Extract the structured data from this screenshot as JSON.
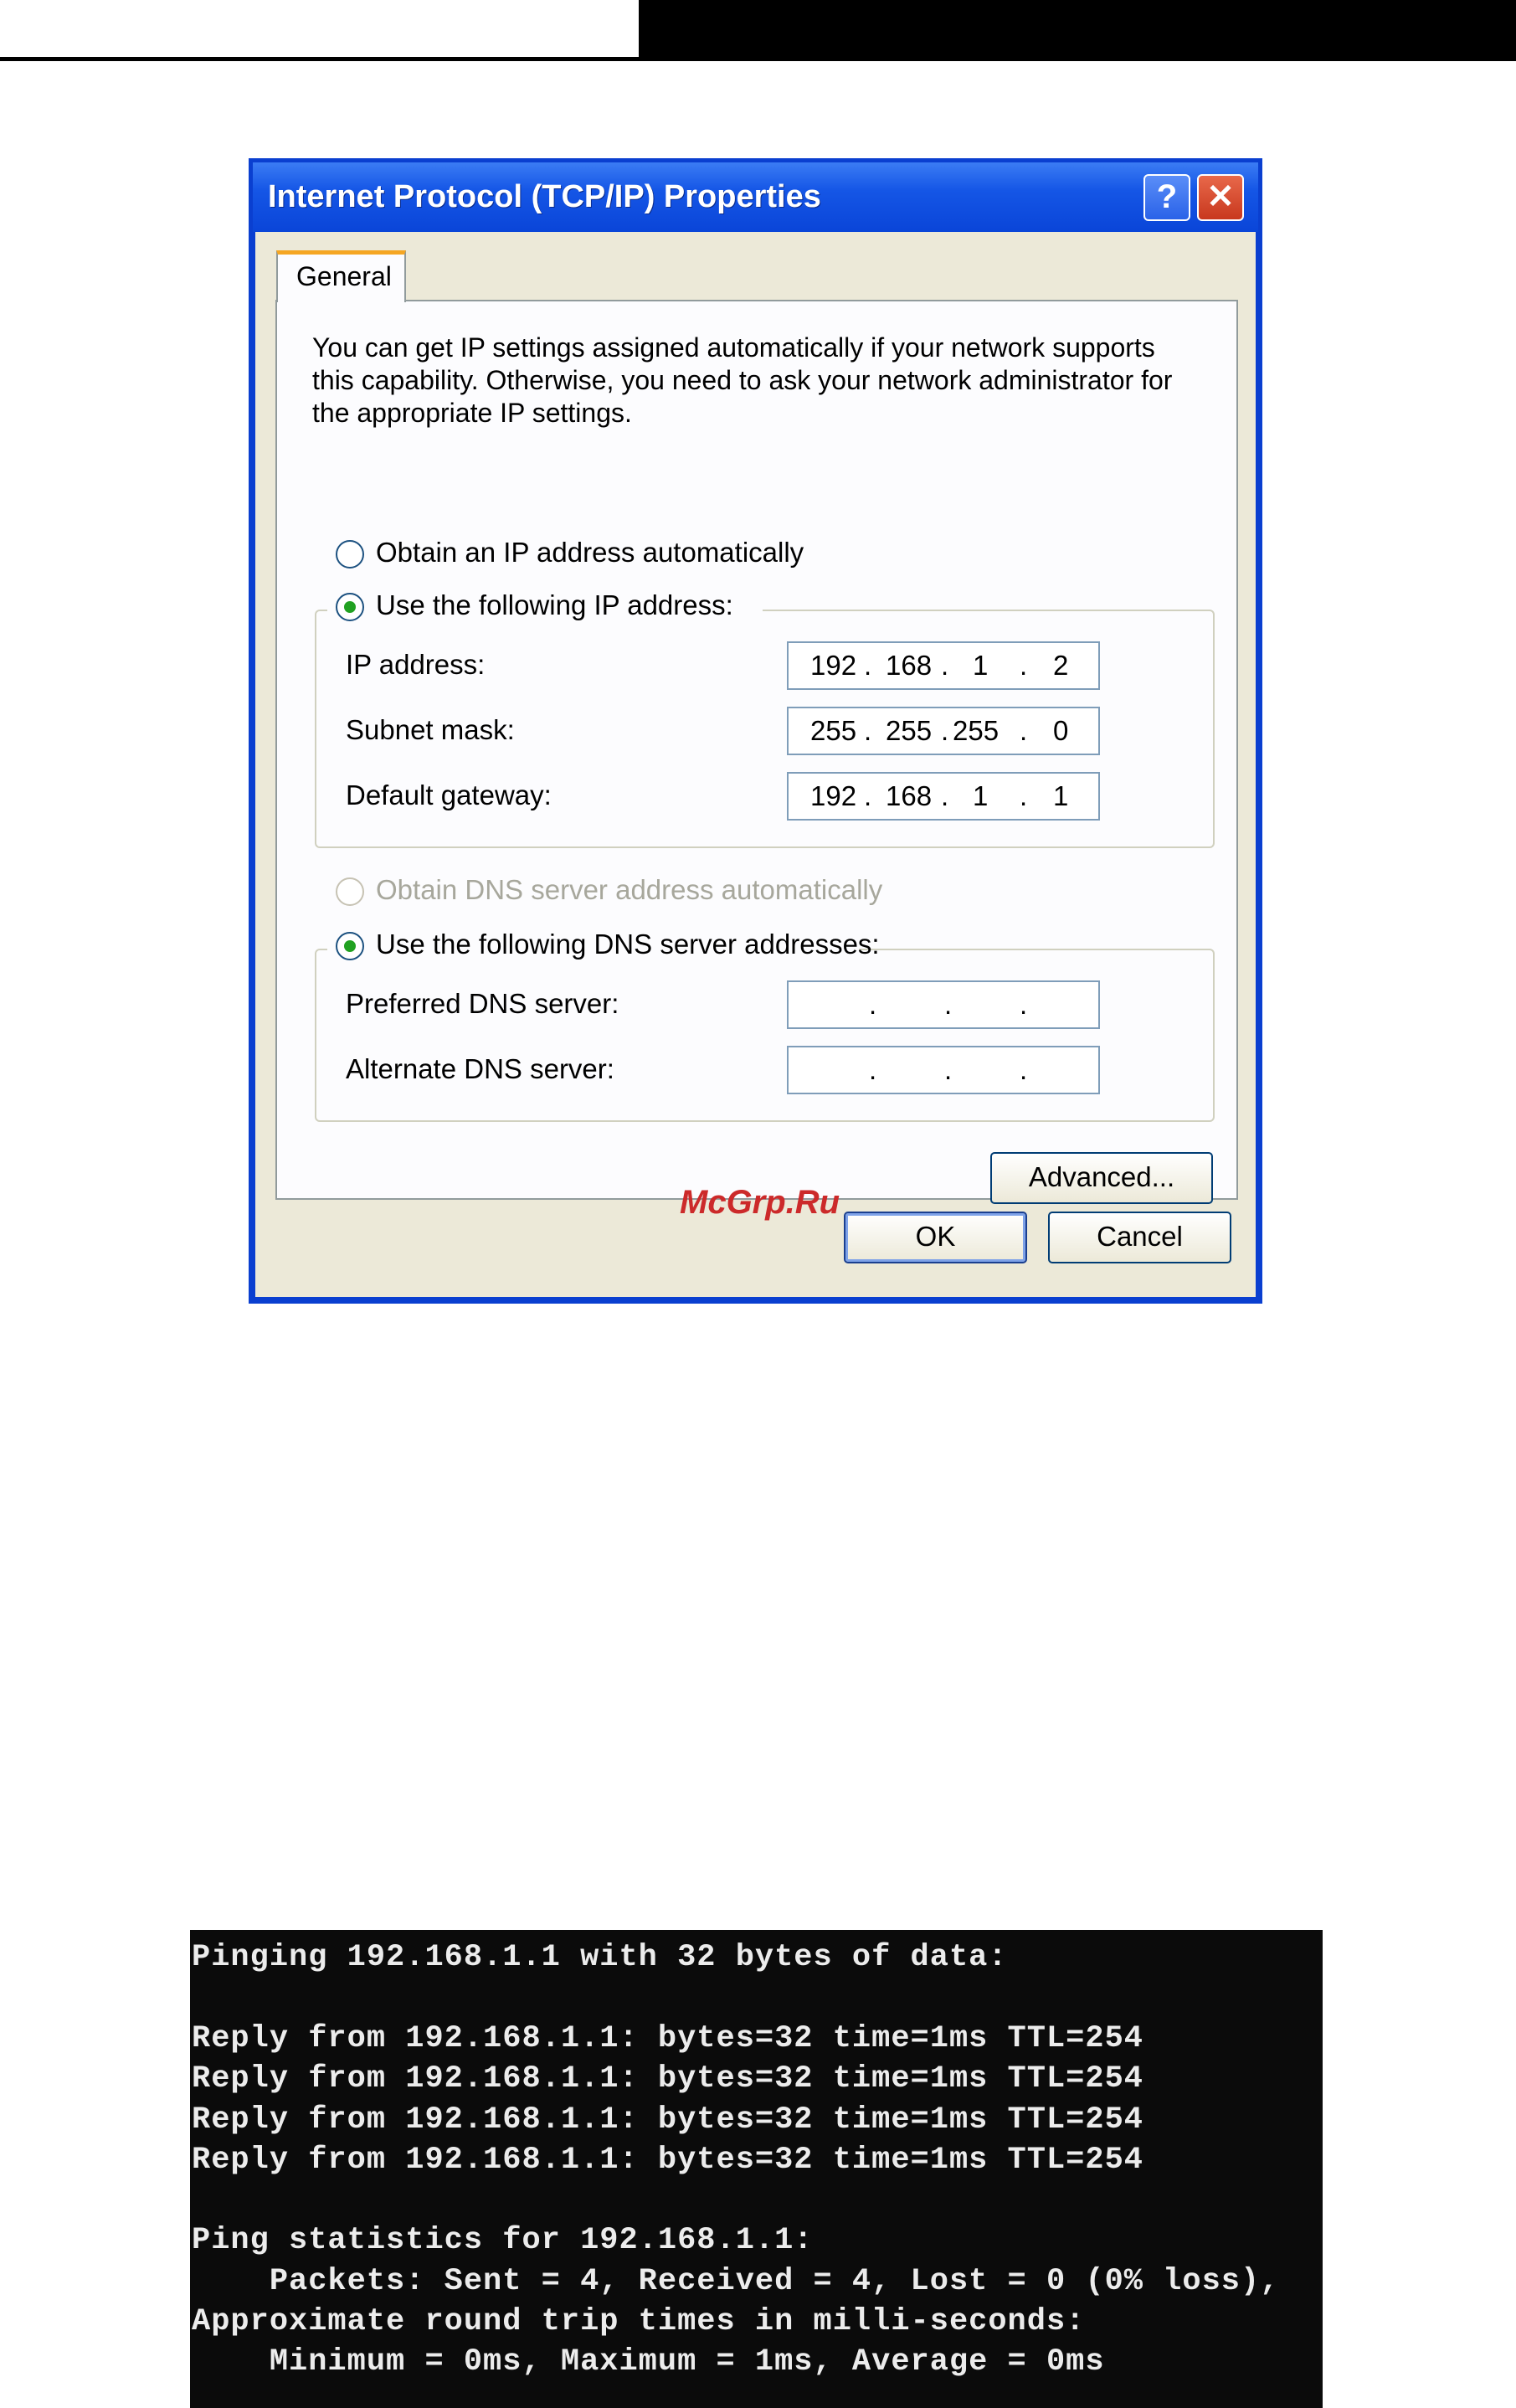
{
  "dialog": {
    "title": "Internet Protocol (TCP/IP) Properties",
    "help_glyph": "?",
    "close_glyph": "✕",
    "tab_label": "General",
    "intro_text": "You can get IP settings assigned automatically if your network supports this capability. Otherwise, you need to ask your network administrator for the appropriate IP settings.",
    "ip_auto_label": "Obtain an IP address automatically",
    "ip_manual_label": "Use the following IP address:",
    "ip_fields": [
      {
        "label": "IP address:",
        "octets": [
          "192",
          "168",
          "1",
          "2"
        ]
      },
      {
        "label": "Subnet mask:",
        "octets": [
          "255",
          "255",
          "255",
          "0"
        ]
      },
      {
        "label": "Default gateway:",
        "octets": [
          "192",
          "168",
          "1",
          "1"
        ]
      }
    ],
    "dns_auto_label": "Obtain DNS server address automatically",
    "dns_manual_label": "Use the following DNS server addresses:",
    "dns_fields": [
      {
        "label": "Preferred DNS server:",
        "octets": [
          "",
          "",
          "",
          ""
        ]
      },
      {
        "label": "Alternate DNS server:",
        "octets": [
          "",
          "",
          "",
          ""
        ]
      }
    ],
    "advanced_label": "Advanced...",
    "ok_label": "OK",
    "cancel_label": "Cancel",
    "selected_ip_option": "manual",
    "selected_dns_option": "manual"
  },
  "watermark": "McGrp.Ru",
  "console": {
    "lines": [
      "Pinging 192.168.1.1 with 32 bytes of data:",
      "",
      "Reply from 192.168.1.1: bytes=32 time=1ms TTL=254",
      "Reply from 192.168.1.1: bytes=32 time=1ms TTL=254",
      "Reply from 192.168.1.1: bytes=32 time=1ms TTL=254",
      "Reply from 192.168.1.1: bytes=32 time=1ms TTL=254",
      "",
      "Ping statistics for 192.168.1.1:",
      "    Packets: Sent = 4, Received = 4, Lost = 0 (0% loss),",
      "Approximate round trip times in milli-seconds:",
      "    Minimum = 0ms, Maximum = 1ms, Average = 0ms"
    ]
  },
  "colors": {
    "title_bar": "#0a45d8",
    "dialog_bg": "#ece9d8",
    "radio_selected": "#21a121",
    "console_bg": "#0b0b0b"
  }
}
